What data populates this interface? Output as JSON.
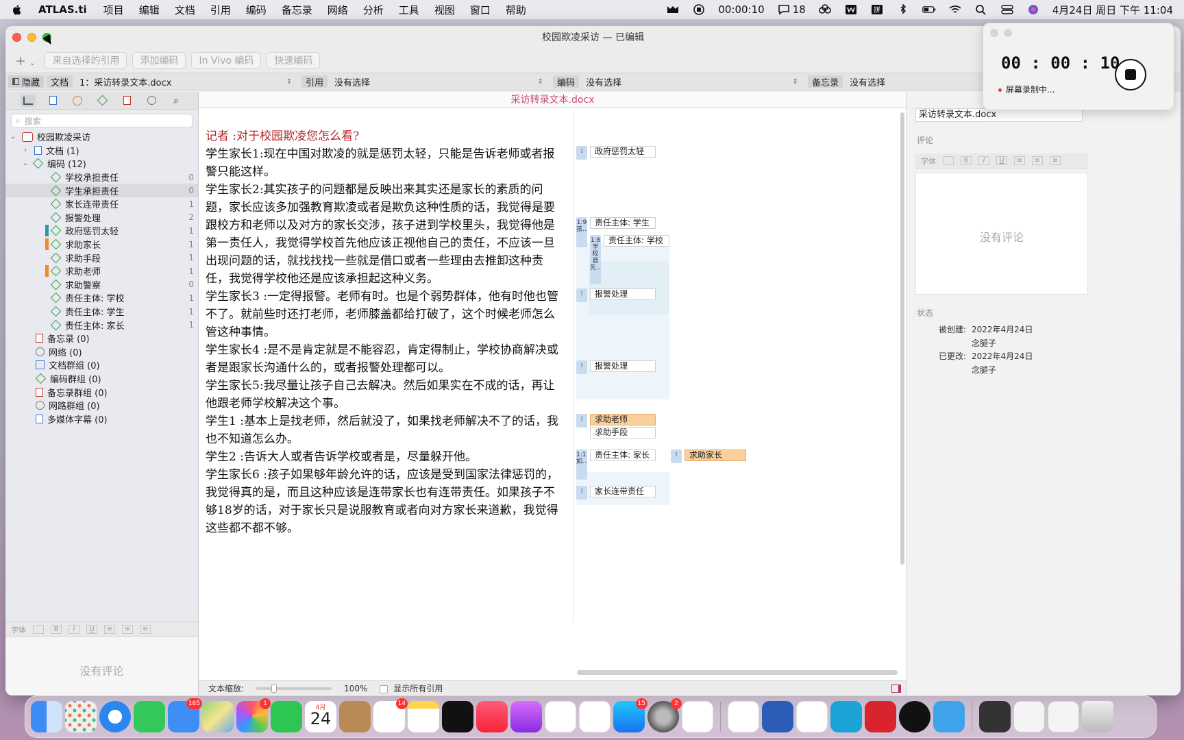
{
  "menubar": {
    "app_name": "ATLAS.ti",
    "menus": [
      "项目",
      "编辑",
      "文档",
      "引用",
      "编码",
      "备忘录",
      "网络",
      "分析",
      "工具",
      "视图",
      "窗口",
      "帮助"
    ],
    "recording_time": "00:00:10",
    "notification_count": "18",
    "datetime": "4月24日 周日 下午 11:04"
  },
  "window": {
    "title": "校园欺凌采访 — 已编辑"
  },
  "toolbar": {
    "buttons": [
      "来自选择的引用",
      "添加编码",
      "In Vivo 编码",
      "快速编码"
    ]
  },
  "selector": {
    "hide_label": "隐藏",
    "doc_label": "文档",
    "doc_value": "1：采访转录文本.docx",
    "quote_label": "引用",
    "quote_value": "没有选择",
    "code_label": "编码",
    "code_value": "没有选择",
    "memo_label": "备忘录",
    "memo_value": "没有选择"
  },
  "left": {
    "search_placeholder": "搜索",
    "project": "校园欺凌采访",
    "documents": "文档 (1)",
    "codes_group": "编码 (12)",
    "codes": [
      {
        "name": "学校承担责任",
        "count": "0",
        "bar": ""
      },
      {
        "name": "学生承担责任",
        "count": "0",
        "bar": ""
      },
      {
        "name": "家长连带责任",
        "count": "1",
        "bar": ""
      },
      {
        "name": "报警处理",
        "count": "2",
        "bar": ""
      },
      {
        "name": "政府惩罚太轻",
        "count": "1",
        "bar": "#2e9aa0"
      },
      {
        "name": "求助家长",
        "count": "1",
        "bar": "#f08a24"
      },
      {
        "name": "求助手段",
        "count": "1",
        "bar": ""
      },
      {
        "name": "求助老师",
        "count": "1",
        "bar": "#f08a24"
      },
      {
        "name": "求助警察",
        "count": "0",
        "bar": ""
      },
      {
        "name": "责任主体: 学校",
        "count": "1",
        "bar": ""
      },
      {
        "name": "责任主体: 学生",
        "count": "1",
        "bar": ""
      },
      {
        "name": "责任主体: 家长",
        "count": "1",
        "bar": ""
      }
    ],
    "others": [
      "备忘录 (0)",
      "网络 (0)",
      "文档群组 (0)",
      "编码群组 (0)",
      "备忘录群组 (0)",
      "网路群组 (0)",
      "多媒体字幕 (0)"
    ],
    "font_label": "字体",
    "no_comment": "没有评论"
  },
  "document": {
    "title": "采访转录文本.docx",
    "paragraphs": [
      "记者 :对于校园欺凌您怎么看?",
      "学生家长1:现在中国对欺凌的就是惩罚太轻，只能是告诉老师或者报警只能这样。",
      "学生家长2:其实孩子的问题都是反映出来其实还是家长的素质的问题，家长应该多加强教育欺凌或者是欺负这种性质的话，我觉得是要跟校方和老师以及对方的家长交涉，孩子进到学校里头，我觉得他是第一责任人，我觉得学校首先他应该正视他自己的责任，不应该一旦出现问题的话，就找找找一些就是借口或者一些理由去推卸这种责任，我觉得学校他还是应该承担起这种义务。",
      "学生家长3 :一定得报警。老师有时。也是个弱势群体，他有时他也管不了。就前些时还打老师，老师膝盖都给打破了，这个时候老师怎么管这种事情。",
      "学生家长4 :是不是肯定就是不能容忍，肯定得制止，学校协商解决或者是跟家长沟通什么的，或者报警处理都可以。",
      "学生家长5:我尽量让孩子自己去解决。然后如果实在不成的话，再让他跟老师学校解决这个事。",
      "学生1 :基本上是找老师，然后就没了，如果找老师解决不了的话，我也不知道怎么办。",
      "学生2 :告诉大人或者告诉学校或者是，尽量躲开他。",
      "学生家长6 :孩子如果够年龄允许的话，应该是受到国家法律惩罚的，我觉得真的是，而且这种应该是连带家长也有连带责任。如果孩子不够18岁的话，对于家长只是说服教育或者向对方家长来道歉，我觉得这些都不都不够。"
    ],
    "margin_codes": [
      {
        "label": "政府惩罚太轻",
        "style": "teal"
      },
      {
        "label": "责任主体: 学生",
        "style": ""
      },
      {
        "label": "责任主体: 学校",
        "style": ""
      },
      {
        "label": "报警处理",
        "style": ""
      },
      {
        "label": "报警处理",
        "style": ""
      },
      {
        "label": "求助老师",
        "style": "orange"
      },
      {
        "label": "求助手段",
        "style": ""
      },
      {
        "label": "责任主体: 家长",
        "style": ""
      },
      {
        "label": "求助家长",
        "style": "orange"
      },
      {
        "label": "家长连带责任",
        "style": ""
      }
    ],
    "bracket_labels": [
      "1:9 孩...",
      "1:8 学校首先...",
      "1:11 如..."
    ],
    "zoom_label": "文本缩放:",
    "zoom_value": "100%",
    "show_all_label": "显示所有引用"
  },
  "inspector": {
    "name": "采访转录文本.docx",
    "comment_label": "评论",
    "font_label": "字体",
    "no_comment": "没有评论",
    "status_label": "状态",
    "created_label": "被创建:",
    "created_date": "2022年4月24日",
    "created_by": "念腿子",
    "modified_label": "已更改:",
    "modified_date": "2022年4月24日",
    "modified_by": "念腿子"
  },
  "recorder": {
    "time": "00 : 00 : 10",
    "status": "屏幕录制中..."
  },
  "dock": {
    "calendar_month": "4月",
    "calendar_day": "24",
    "badges": {
      "mail": "165",
      "photos": "1",
      "reminders": "14",
      "appstore": "15",
      "settings": "2"
    }
  }
}
